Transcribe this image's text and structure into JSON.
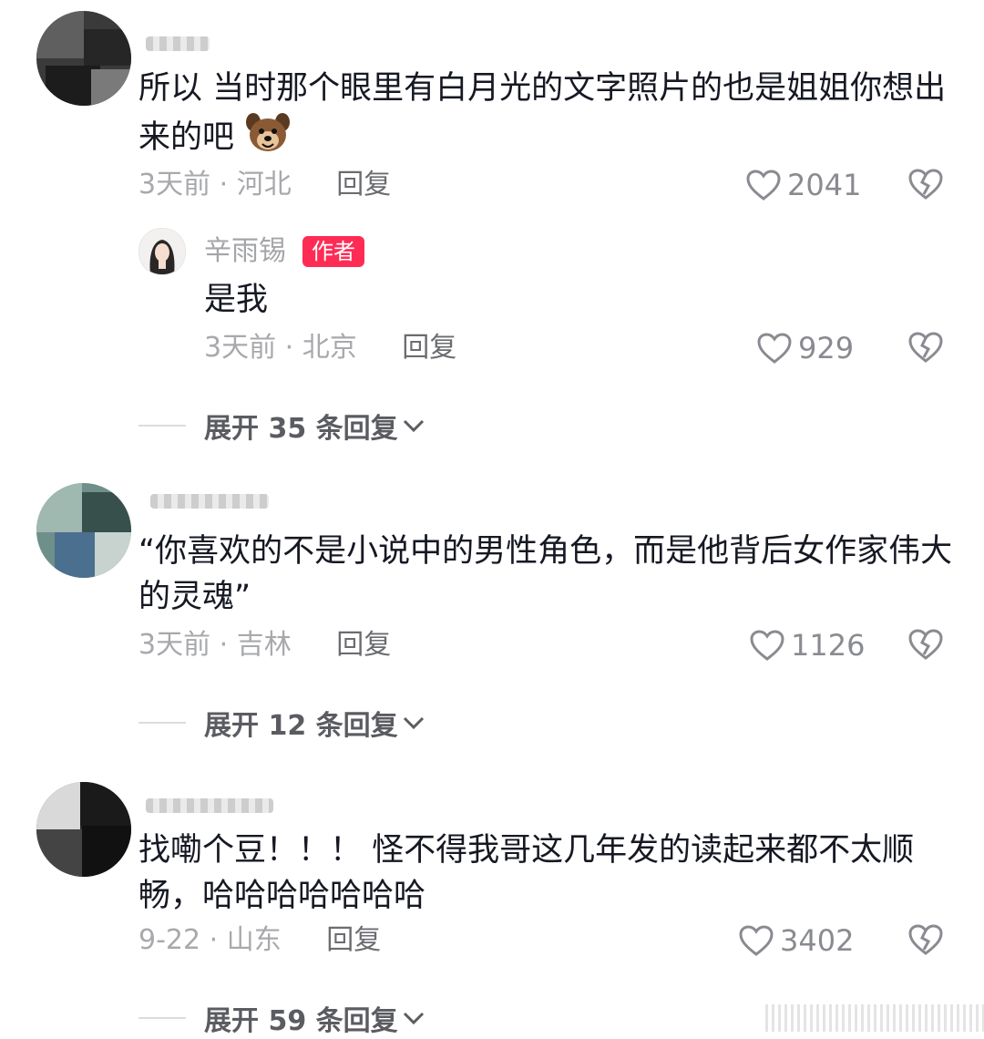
{
  "comments": [
    {
      "text": "所以 当时那个眼里有白月光的文字照片的也是姐姐你想出来的吧",
      "time": "3天前",
      "location": "河北",
      "reply_label": "回复",
      "likes": "2041",
      "sub_reply": {
        "name": "辛雨锡",
        "badge": "作者",
        "text": "是我",
        "time": "3天前",
        "location": "北京",
        "reply_label": "回复",
        "likes": "929"
      },
      "expand_label": "展开 35 条回复"
    },
    {
      "text": "“你喜欢的不是小说中的男性角色，而是他背后女作家伟大的灵魂”",
      "time": "3天前",
      "location": "吉林",
      "reply_label": "回复",
      "likes": "1126",
      "expand_label": "展开 12 条回复"
    },
    {
      "text": "找嘞个豆！！！ 怪不得我哥这几年发的读起来都不太顺畅，哈哈哈哈哈哈哈",
      "time": "9-22",
      "location": "山东",
      "reply_label": "回复",
      "likes": "3402",
      "expand_label": "展开 59 条回复"
    }
  ],
  "separator": "·",
  "icons": {
    "like": "heart-outline-icon",
    "dislike": "broken-heart-icon",
    "expand": "chevron-down-icon",
    "emoji": "dog-emoji-icon"
  },
  "colors": {
    "author_badge": "#fe2c55",
    "meta_text": "#a8a9ac",
    "body_text": "#161823"
  }
}
